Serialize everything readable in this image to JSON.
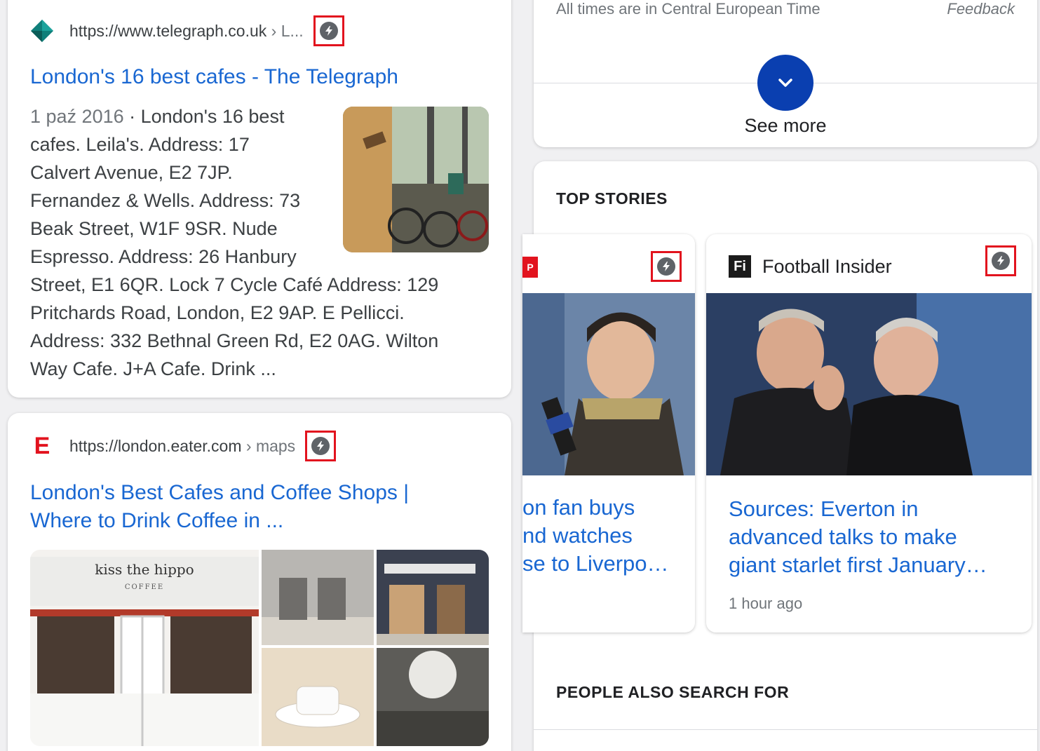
{
  "results": [
    {
      "url": "https://www.telegraph.co.uk",
      "url_path": " › L...",
      "title": "London's 16 best cafes - The Telegraph",
      "date": "1 paź 2016",
      "snippet_lines": [
        "cafes. Leila's. Address: 17",
        "Calvert Avenue, E2 7JP.",
        "Fernandez & Wells. Address: 73",
        "Beak Street, W1F 9SR. Nude",
        "Espresso. Address: 26 Hanbury",
        "Street, E1 6QR. Lock 7 Cycle Café Address: 129",
        "Pritchards Road, London, E2 9AP. E Pellicci.",
        "Address: 332 Bethnal Green Rd, E2 0AG. Wilton",
        "Way Cafe. J+A Cafe. Drink ..."
      ],
      "snippet_first": " · London's 16 best",
      "favicon": "telegraph-diamond-icon",
      "amp_icon": "amp-lightning-icon"
    },
    {
      "url": "https://london.eater.com",
      "url_path": " › maps",
      "title_lines": [
        "London's Best Cafes and Coffee Shops |",
        "Where to Drink Coffee in ..."
      ],
      "favicon_letter": "E",
      "favicon_color": "#e2131e",
      "amp_icon": "amp-lightning-icon",
      "image_sign": [
        "kiss the hippo",
        "COFFEE"
      ]
    }
  ],
  "times_panel": {
    "note": "All times are in Central European Time",
    "feedback": "Feedback",
    "see_more": "See more",
    "see_more_icon": "chevron-down-icon"
  },
  "top_stories": {
    "title": "TOP STORIES",
    "stories": [
      {
        "source_badge": "P",
        "headline_lines": [
          "on fan buys",
          "nd watches",
          "se to Liverpo…"
        ]
      },
      {
        "source_logo": "Fi",
        "source_name": "Football Insider",
        "headline_lines": [
          "Sources: Everton in",
          "advanced talks to make",
          "giant starlet first January…"
        ],
        "time": "1 hour ago"
      }
    ]
  },
  "people_also_search": {
    "title": "PEOPLE ALSO SEARCH FOR"
  },
  "colors": {
    "link": "#1967d2",
    "amp_highlight": "#e2131e",
    "see_more_button": "#0a3fb0"
  }
}
